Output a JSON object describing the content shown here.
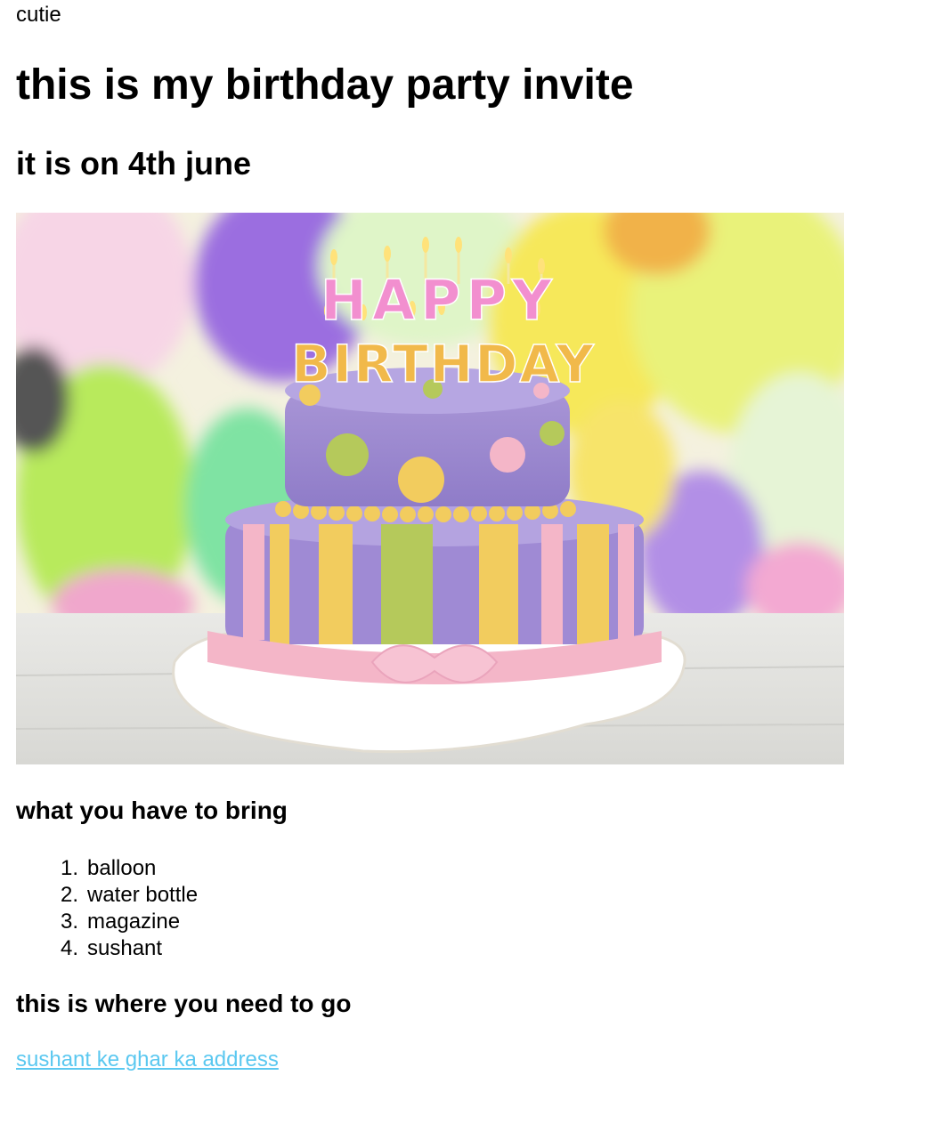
{
  "top_text": "cutie",
  "heading": "this is my birthday party invite",
  "subheading": "it is on 4th june",
  "image": {
    "candles_line1": "HAPPY",
    "candles_line2": "BIRTHDAY"
  },
  "bring": {
    "heading": "what you have to bring",
    "items": [
      {
        "num": "1.",
        "text": "balloon"
      },
      {
        "num": "2.",
        "text": "water bottle"
      },
      {
        "num": "3.",
        "text": "magazine"
      },
      {
        "num": "4.",
        "text": "sushant"
      }
    ]
  },
  "location": {
    "heading": "this is where you need to go",
    "link_text": "sushant ke ghar ka address"
  },
  "colors": {
    "link": "#5bc8f0",
    "cake_purple": "#a08cd2",
    "cake_pink": "#f4b6c8",
    "cake_yellow": "#f2cc5e",
    "cake_green": "#b5c95b"
  }
}
